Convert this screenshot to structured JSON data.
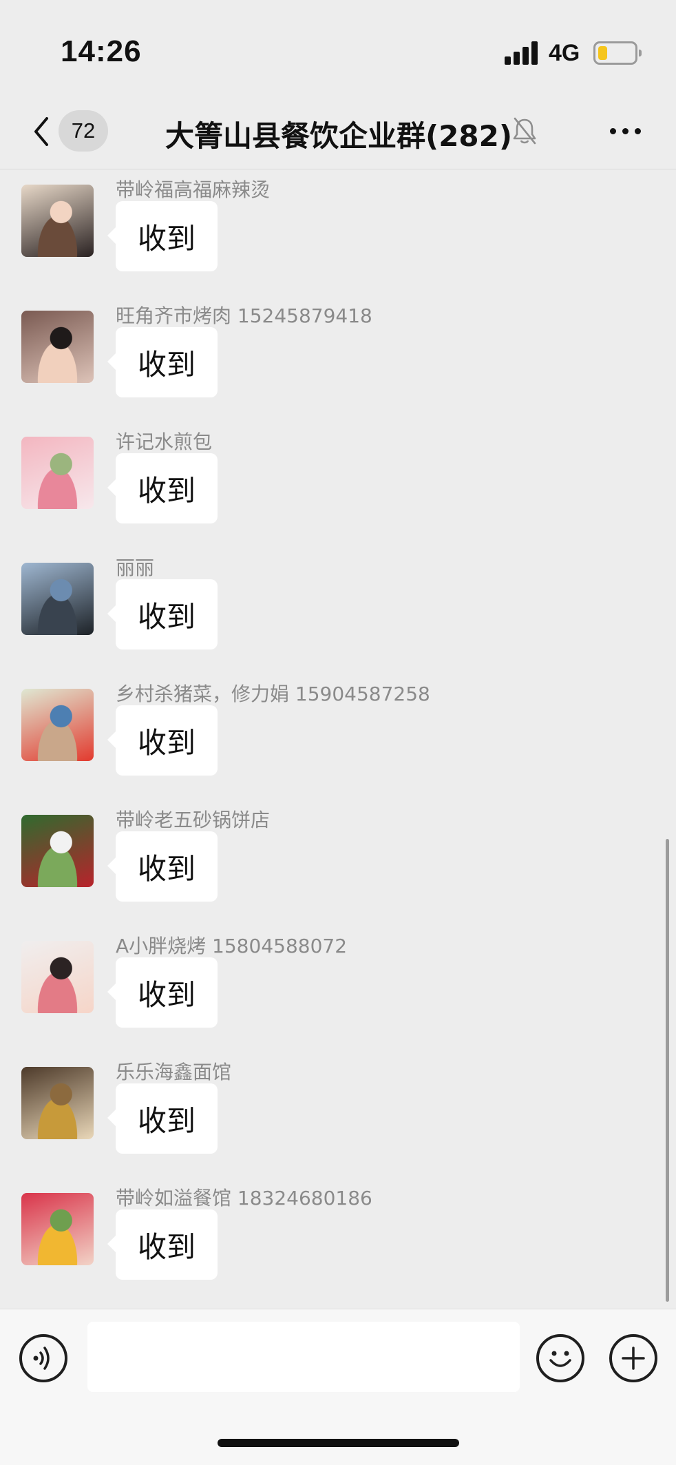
{
  "status_bar": {
    "time": "14:26",
    "network": "4G",
    "battery_level": 0.25,
    "battery_color": "#f5c51c"
  },
  "nav": {
    "unread_count": "72",
    "title": "大箐山县餐饮企业群(282)",
    "muted": true
  },
  "messages": [
    {
      "sender": "带岭福高福麻辣烫",
      "text": "收到",
      "avatar_palette": [
        "#e7d8c8",
        "#6a4b3a",
        "#f2d4c2",
        "#2a2222"
      ]
    },
    {
      "sender": "旺角齐市烤肉 15245879418",
      "text": "收到",
      "avatar_palette": [
        "#7a5a52",
        "#f1d0bd",
        "#1f1a1a",
        "#ddc3b8"
      ]
    },
    {
      "sender": "许记水煎包",
      "text": "收到",
      "avatar_palette": [
        "#f3b6c0",
        "#e8879a",
        "#9bb57e",
        "#f7e8ec"
      ]
    },
    {
      "sender": "丽丽",
      "text": "收到",
      "avatar_palette": [
        "#9fb7d1",
        "#39434f",
        "#6c8cb0",
        "#1d2227"
      ]
    },
    {
      "sender": "乡村杀猪菜，修力娟 15904587258",
      "text": "收到",
      "avatar_palette": [
        "#dfe8d3",
        "#c9a78a",
        "#4d7fb2",
        "#e23a2e"
      ]
    },
    {
      "sender": "带岭老五砂锅饼店",
      "text": "收到",
      "avatar_palette": [
        "#2f6b2f",
        "#7ba95b",
        "#f2f2f2",
        "#b8232b"
      ]
    },
    {
      "sender": "A小胖烧烤 15804588072",
      "text": "收到",
      "avatar_palette": [
        "#f0eeee",
        "#e37b86",
        "#2c2323",
        "#f6d5c8"
      ]
    },
    {
      "sender": "乐乐海鑫面馆",
      "text": "收到",
      "avatar_palette": [
        "#4d3a2a",
        "#c79a3a",
        "#8c6a3e",
        "#e9d7b8"
      ]
    },
    {
      "sender": "带岭如溢餐馆 18324680186",
      "text": "收到",
      "avatar_palette": [
        "#d9344a",
        "#f1b731",
        "#6f9f4f",
        "#f2d3c7"
      ]
    }
  ],
  "input": {
    "placeholder": ""
  },
  "icons": {
    "back": "chevron-left-icon",
    "mute": "bell-slash-icon",
    "more": "ellipsis-icon",
    "voice": "voice-icon",
    "emoji": "smiley-icon",
    "plus": "plus-icon"
  }
}
